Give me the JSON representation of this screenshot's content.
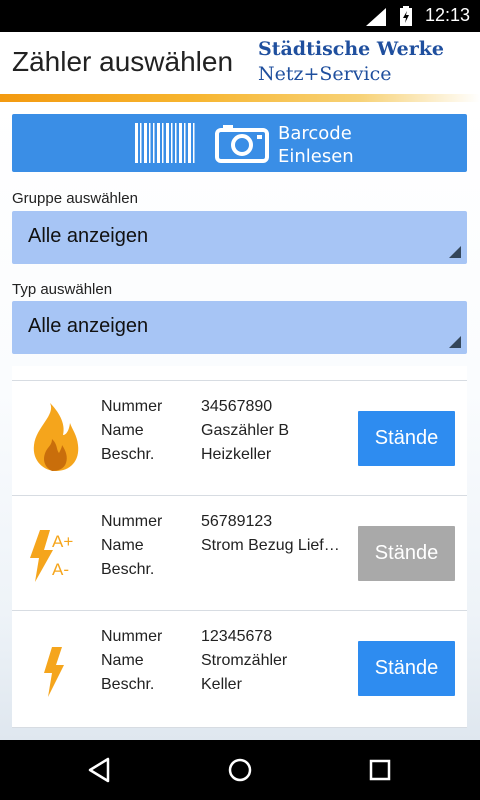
{
  "status_bar": {
    "time": "12:13"
  },
  "header": {
    "title": "Zähler auswählen",
    "brand_line1": "Städtische Werke",
    "brand_line2": "Netz+Service"
  },
  "barcode": {
    "line1": "Barcode",
    "line2": "Einlesen",
    "icons": [
      "barcode-icon",
      "camera-icon"
    ]
  },
  "group": {
    "label": "Gruppe auswählen",
    "value": "Alle anzeigen"
  },
  "type": {
    "label": "Typ auswählen",
    "value": "Alle anzeigen"
  },
  "field_labels": {
    "number": "Nummer",
    "name": "Name",
    "description": "Beschr."
  },
  "meters": [
    {
      "icon": "gas-flame-icon",
      "number": "34567890",
      "name": "Gaszähler B",
      "description": "Heizkeller",
      "button": "Stände",
      "enabled": true
    },
    {
      "icon": "electricity-bidirectional-icon",
      "number": "56789123",
      "name": "Strom Bezug Lief…",
      "description": "",
      "button": "Stände",
      "enabled": false
    },
    {
      "icon": "electricity-icon",
      "number": "12345678",
      "name": "Stromzähler",
      "description": "Keller",
      "button": "Stände",
      "enabled": true
    }
  ],
  "colors": {
    "accent": "#2e8cf0",
    "select_bg": "#a7c5f5",
    "brand": "#1f4f9e",
    "stripe": "#f39a10",
    "icon_orange": "#f5a51c",
    "disabled": "#a9a9a9"
  },
  "navbar": {
    "icons": [
      "back-icon",
      "home-icon",
      "recents-icon"
    ]
  }
}
